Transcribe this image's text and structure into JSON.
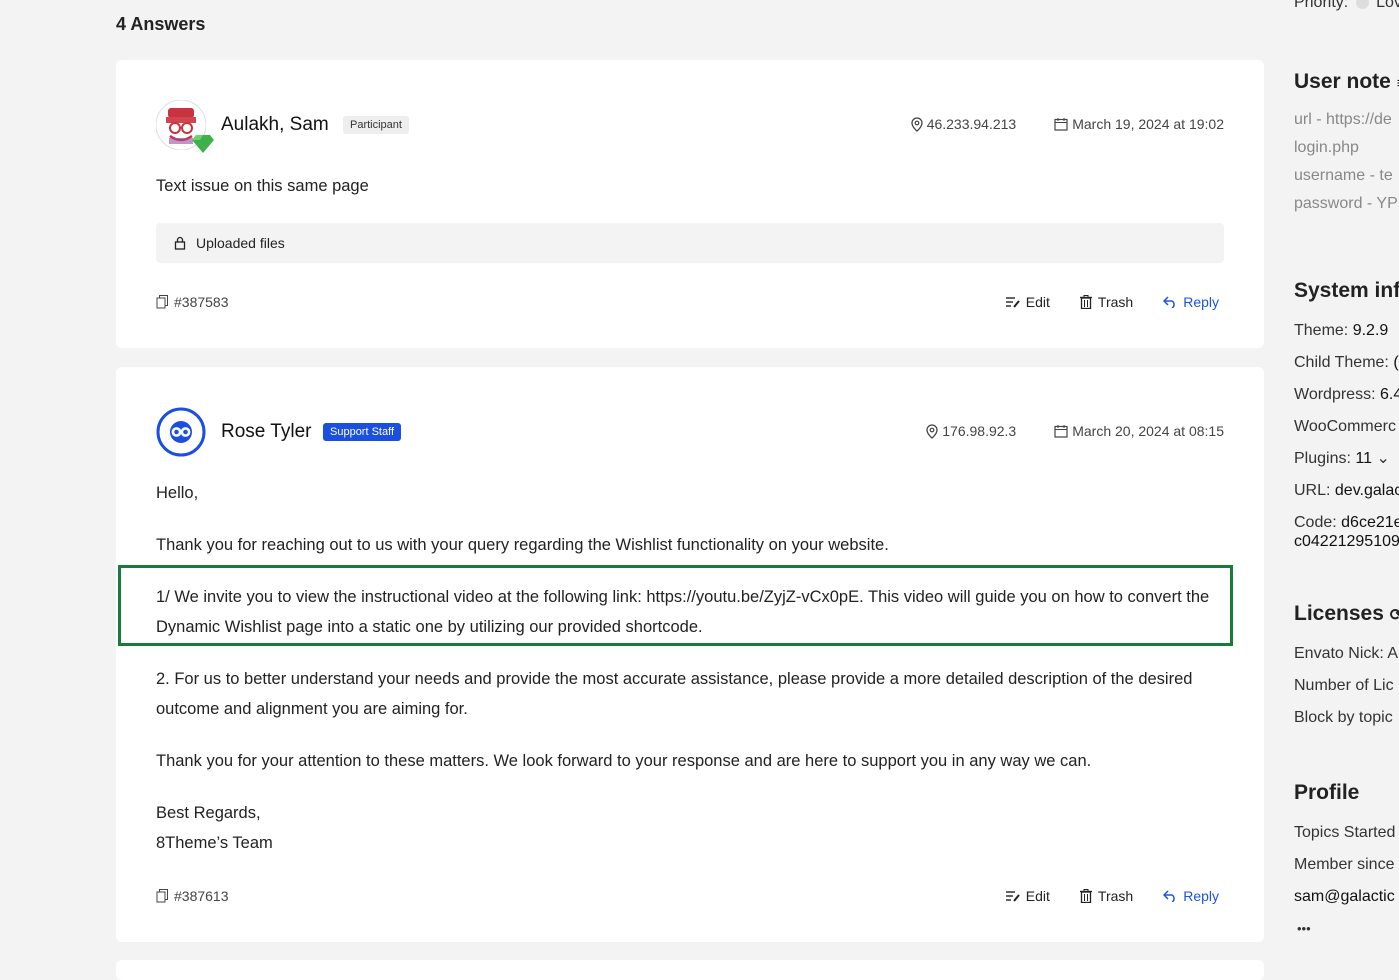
{
  "answers": {
    "count_label": "4 Answers"
  },
  "posts": [
    {
      "author": "Aulakh, Sam",
      "role": "Participant",
      "ip": "46.233.94.213",
      "date": "March 19, 2024 at 19:02",
      "body": [
        "Text issue on this same page"
      ],
      "files_label": "Uploaded files",
      "id": "#387583"
    },
    {
      "author": "Rose Tyler",
      "role": "Support Staff",
      "ip": "176.98.92.3",
      "date": "March 20, 2024 at 08:15",
      "body": [
        "Hello,",
        "Thank you for reaching out to us with your query regarding the Wishlist functionality on your website.",
        "1/ We invite you to view the instructional video at the following link: https://youtu.be/ZyjZ-vCx0pE. This video will guide you on how to convert the Dynamic Wishlist page into a static one by utilizing our provided shortcode.",
        "2. For us to better understand your needs and provide the most accurate assistance, please provide a more detailed description of the desired outcome and alignment you are aiming for.",
        "Thank you for your attention to these matters. We look forward to your response and are here to support you in any way we can.",
        "Best Regards,",
        "8Theme’s Team"
      ],
      "id": "#387613"
    }
  ],
  "actions": {
    "edit": "Edit",
    "trash": "Trash",
    "reply": "Reply"
  },
  "sidebar": {
    "priority_label": "Priority:",
    "priority_value": "Lov",
    "user_note": {
      "title": "User note",
      "lines": [
        "url - https://de",
        "login.php",
        "username - te",
        "password - YP"
      ]
    },
    "system_info": {
      "title": "System inf",
      "rows": [
        {
          "label": "Theme:",
          "value": "9.2.9"
        },
        {
          "label": "Child Theme:",
          "value": "("
        },
        {
          "label": "Wordpress:",
          "value": "6.4"
        },
        {
          "label": "WooCommerc",
          "value": ""
        },
        {
          "label": "Plugins:",
          "value": "11"
        },
        {
          "label": "URL:",
          "value": "dev.galac"
        },
        {
          "label": "Code:",
          "value": "d6ce21e"
        }
      ],
      "code_line2": "c04221295109"
    },
    "licenses": {
      "title": "Licenses",
      "rows": [
        "Envato Nick: A",
        "Number of Lic",
        "Block by topic"
      ]
    },
    "profile": {
      "title": "Profile",
      "rows": [
        "Topics Started",
        "Member since",
        "sam@galactic"
      ],
      "more": "•••"
    }
  }
}
